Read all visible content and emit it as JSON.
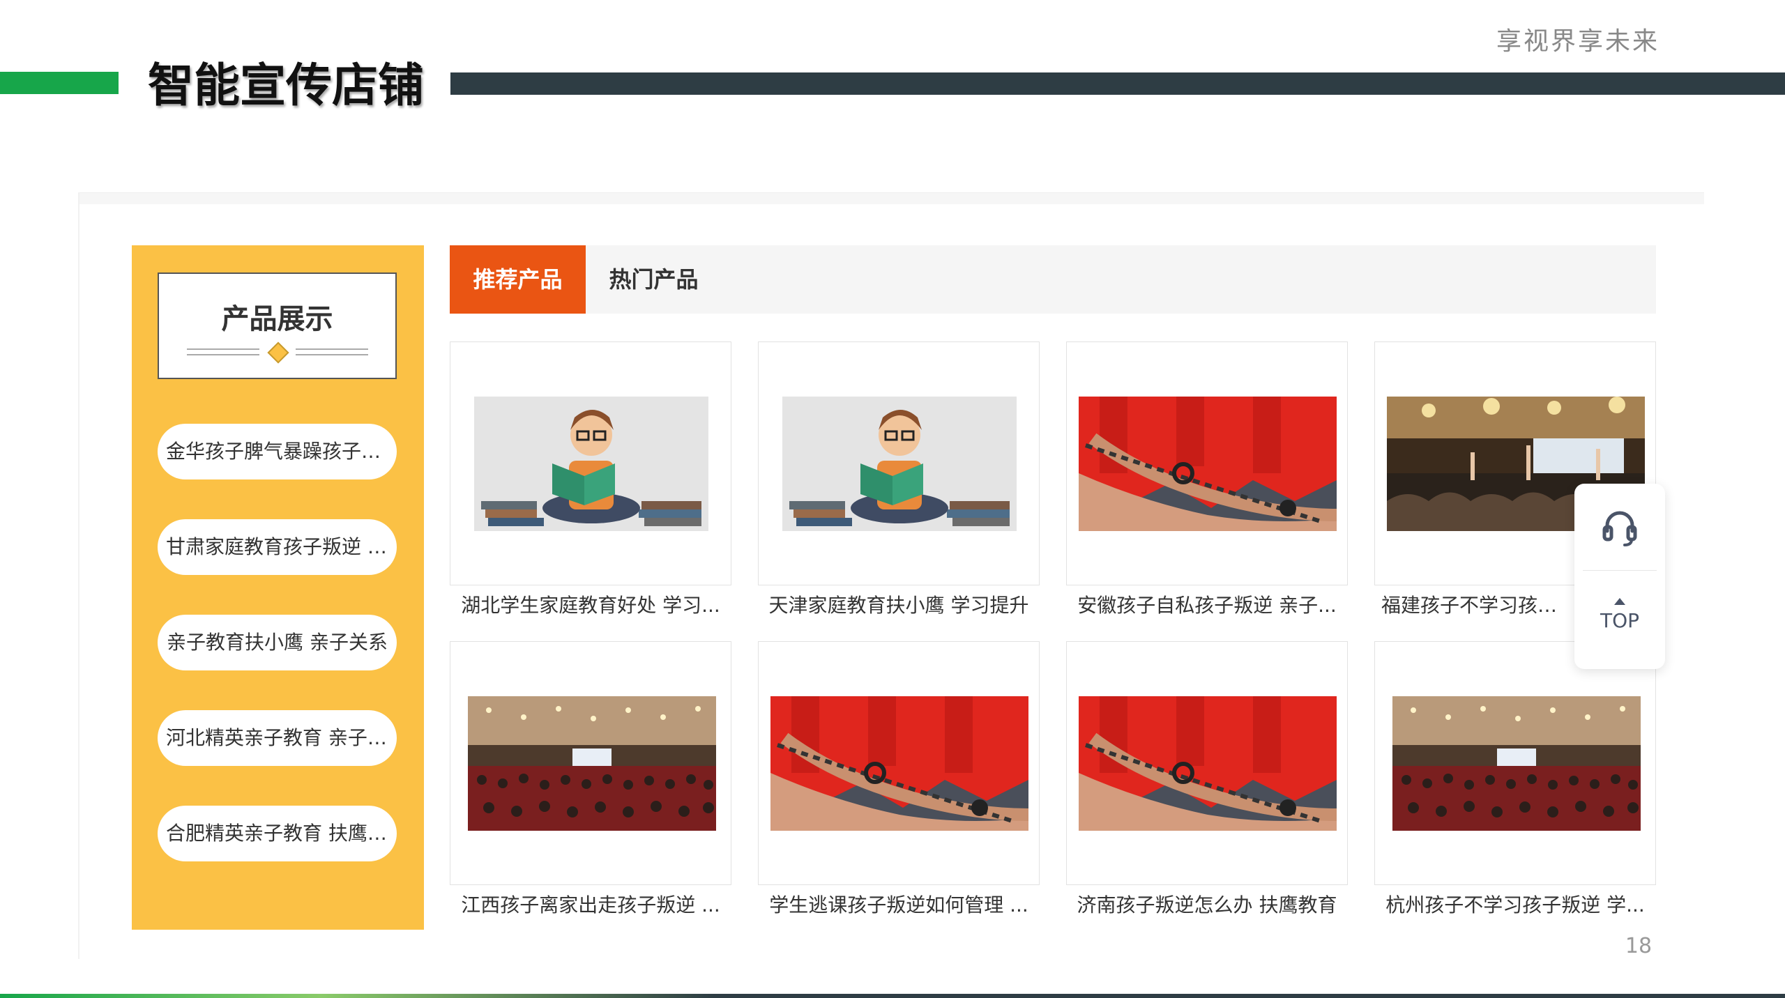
{
  "slide": {
    "slogan": "享视界享未来",
    "title": "智能宣传店铺",
    "page_number": "18",
    "accent_green": "#17a64a",
    "bar_dark": "#2e3d44"
  },
  "store": {
    "sidebar": {
      "title": "产品展示",
      "background": "#fbc145",
      "items": [
        {
          "label": "金华孩子脾气暴躁孩子叛..."
        },
        {
          "label": "甘肃家庭教育孩子叛逆 学..."
        },
        {
          "label": "亲子教育扶小鹰 亲子关系"
        },
        {
          "label": "河北精英亲子教育 亲子关系"
        },
        {
          "label": "合肥精英亲子教育 扶鹰教育"
        }
      ]
    },
    "tabs": [
      {
        "label": "推荐产品",
        "active": true,
        "color": "#ea5513"
      },
      {
        "label": "热门产品",
        "active": false
      }
    ],
    "products": [
      {
        "caption": "湖北学生家庭教育好处 学习...",
        "image": "reading-cartoon"
      },
      {
        "caption": "天津家庭教育扶小鹰 学习提升",
        "image": "reading-cartoon"
      },
      {
        "caption": "安徽孩子自私孩子叛逆 亲子...",
        "image": "red-shirts-hands"
      },
      {
        "caption": "福建孩子不学习孩子叛逆",
        "image": "conference-hall"
      },
      {
        "caption": "江西孩子离家出走孩子叛逆 ...",
        "image": "auditorium"
      },
      {
        "caption": "学生逃课孩子叛逆如何管理 ...",
        "image": "red-shirts-hands"
      },
      {
        "caption": "济南孩子叛逆怎么办 扶鹰教育",
        "image": "red-shirts-hands"
      },
      {
        "caption": "杭州孩子不学习孩子叛逆 学...",
        "image": "auditorium"
      }
    ],
    "float_widget": {
      "service_icon": "headset-icon",
      "top_label": "TOP"
    }
  }
}
